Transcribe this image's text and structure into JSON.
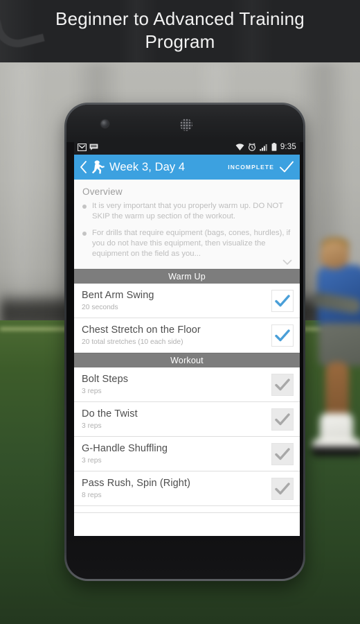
{
  "caption": {
    "text": "Beginner to Advanced Training Program"
  },
  "phone": {
    "status_bar": {
      "left_icons": [
        "gmail-icon",
        "messaging-icon"
      ],
      "right_icons": [
        "wifi-icon",
        "alarm-icon",
        "signal-icon",
        "battery-icon"
      ],
      "time": "9:35"
    },
    "app_bar": {
      "back_icon": "back-chevron-icon",
      "logo_icon": "football-player-logo",
      "title": "Week 3, Day 4",
      "status_label": "INCOMPLETE",
      "check_icon": "check-outline-icon",
      "background_color": "#3ca1e0"
    },
    "overview": {
      "title": "Overview",
      "bullets": [
        "It is very important that you properly warm up. DO NOT SKIP the warm up section of the workout.",
        "For drills that require equipment (bags, cones, hurdles), if you do not have this equipment, then visualize the equipment on the field as you..."
      ],
      "expand_icon": "chevron-down-icon"
    },
    "sections": [
      {
        "header": "Warm Up",
        "items": [
          {
            "title": "Bent Arm Swing",
            "detail": "20 seconds",
            "completed": true
          },
          {
            "title": "Chest Stretch on the Floor",
            "detail": "20 total stretches (10 each side)",
            "completed": true
          }
        ]
      },
      {
        "header": "Workout",
        "items": [
          {
            "title": "Bolt Steps",
            "detail": "3 reps",
            "completed": false
          },
          {
            "title": "Do the Twist",
            "detail": "3 reps",
            "completed": false
          },
          {
            "title": "G-Handle Shuffling",
            "detail": "3 reps",
            "completed": false
          },
          {
            "title": "Pass Rush, Spin (Right)",
            "detail": "8 reps",
            "completed": false
          }
        ]
      }
    ],
    "colors": {
      "accent": "#3ca1e0",
      "check_done": "#4a9fd8",
      "check_pending": "#a8a8a8",
      "section_header": "#7d7d7d"
    }
  }
}
